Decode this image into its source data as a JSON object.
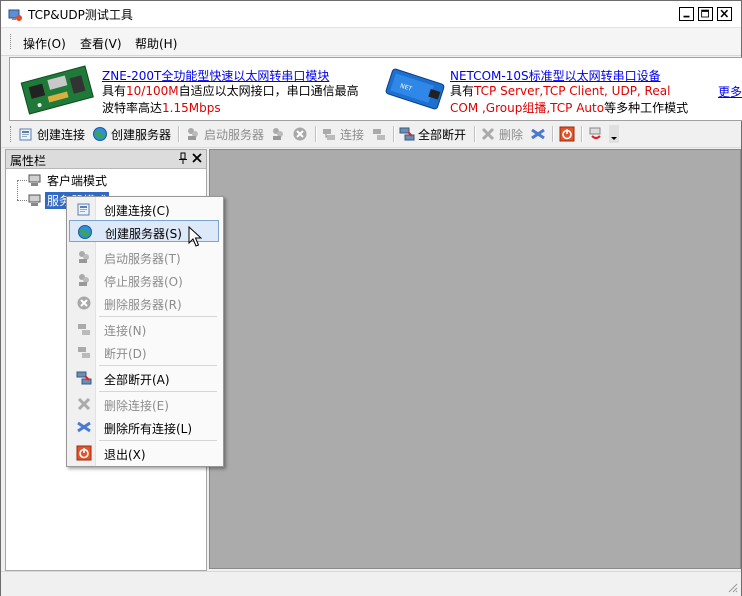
{
  "window": {
    "title": "TCP&UDP测试工具",
    "icon": "app-icon"
  },
  "menubar": {
    "items": [
      "操作(O)",
      "查看(V)",
      "帮助(H)"
    ]
  },
  "banner": {
    "ad1": {
      "link": "ZNE-200T全功能型快速以太网转串口模块",
      "line1_a": "具有",
      "line1_b": "10/100M",
      "line1_c": "自适应以太网接口，串口通信最高",
      "line2_a": "波特率高达",
      "line2_b": "1.15Mbps"
    },
    "ad2": {
      "link": "NETCOM-10S标准型以太网转串口设备",
      "line1_a": "具有",
      "line1_b": "TCP Server,TCP Client, UDP, Real",
      "line2_b": "COM ,Group组播,TCP Auto",
      "line2_c": "等多种工作模式"
    },
    "more_link": "更多"
  },
  "toolbar": {
    "create_connection": "创建连接",
    "create_server": "创建服务器",
    "start_server": "启动服务器",
    "connect": "连接",
    "disconnect_all": "全部断开",
    "delete": "删除"
  },
  "panel": {
    "title": "属性栏",
    "tree": [
      "客户端模式",
      "服务器模式"
    ]
  },
  "context_menu": {
    "items": [
      {
        "label": "创建连接(C)",
        "icon": "new-connection-icon",
        "enabled": true
      },
      {
        "label": "创建服务器(S)",
        "icon": "globe-server-icon",
        "enabled": true
      },
      {
        "label": "启动服务器(T)",
        "icon": "start-server-icon",
        "enabled": false
      },
      {
        "label": "停止服务器(O)",
        "icon": "stop-server-icon",
        "enabled": false
      },
      {
        "label": "删除服务器(R)",
        "icon": "delete-server-icon",
        "enabled": false
      },
      {
        "label": "连接(N)",
        "icon": "connect-icon",
        "enabled": false
      },
      {
        "label": "断开(D)",
        "icon": "disconnect-icon",
        "enabled": false
      },
      {
        "label": "全部断开(A)",
        "icon": "disconnect-all-icon",
        "enabled": true
      },
      {
        "label": "删除连接(E)",
        "icon": "delete-connection-icon",
        "enabled": false
      },
      {
        "label": "删除所有连接(L)",
        "icon": "delete-all-connections-icon",
        "enabled": true
      },
      {
        "label": "退出(X)",
        "icon": "exit-icon",
        "enabled": true
      }
    ]
  },
  "colors": {
    "accent_red": "#e00000",
    "link_blue": "#0000ee",
    "selection": "#3169c6",
    "hover": "#dde8f8",
    "mdi_background": "#ababab"
  }
}
